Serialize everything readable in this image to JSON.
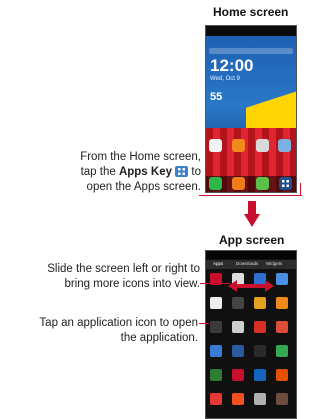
{
  "home": {
    "title": "Home screen",
    "time": "12:00",
    "temp": "55",
    "date_text": "Wed, Oct 9"
  },
  "apps": {
    "title": "App screen",
    "tabs": [
      "Apps",
      "Downloads",
      "Widgets"
    ]
  },
  "captions": {
    "apps_key_pre": "From the Home screen,",
    "apps_key_mid_a": "tap the ",
    "apps_key_bold": "Apps Key",
    "apps_key_mid_b": " to",
    "apps_key_post": "open the Apps screen.",
    "slide_1": "Slide the screen left or right to",
    "slide_2": "bring more icons into view.",
    "tap_1": "Tap an application icon to open",
    "tap_2": "the application."
  },
  "colors": {
    "accent_line": "#c8102e",
    "arrow": "#c8102e"
  },
  "icons": [
    "apps-key-icon",
    "down-arrow-icon",
    "double-arrow-icon"
  ]
}
